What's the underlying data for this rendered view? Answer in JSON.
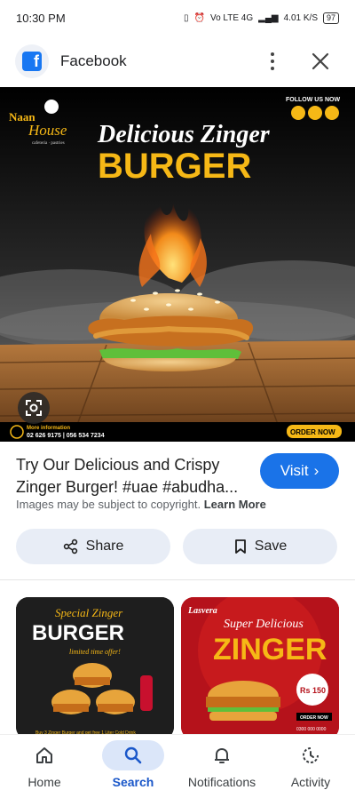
{
  "status_bar": {
    "time": "10:30 PM",
    "network": "Vo LTE 4G",
    "speed": "4.01 K/S",
    "battery": "97"
  },
  "header": {
    "app_title": "Facebook"
  },
  "hero": {
    "brand_top": "Naan",
    "brand_bottom": "House",
    "brand_sub": "cafeteria · pastries",
    "follow_text": "FOLLOW US NOW",
    "headline_1": "Delicious Zinger",
    "headline_2": "BURGER",
    "info_label": "More information",
    "phones": "02 626 9175 | 056 534 7234",
    "order_text": "ORDER NOW"
  },
  "result": {
    "title": "Try Our Delicious and Crispy Zinger Burger! #uae #abudha...",
    "visit_label": "Visit",
    "copyright_text": "Images may be subject to copyright.",
    "learn_more": "Learn More"
  },
  "actions": {
    "share_label": "Share",
    "save_label": "Save"
  },
  "related": [
    {
      "line1": "Special Zinger",
      "line2": "BURGER",
      "tag": "limited time offer!",
      "footer": "Buy 3 Zinger Burger and get free 1 Liter Cold Drink"
    },
    {
      "brand": "Lasvera",
      "line1": "Super Delicious",
      "line2": "ZINGER",
      "price": "Rs 150 Only",
      "order": "ORDER NOW",
      "footer": "0300 000 0000"
    }
  ],
  "nav": {
    "home": "Home",
    "search": "Search",
    "notifications": "Notifications",
    "activity": "Activity"
  },
  "colors": {
    "accent": "#1a73e8",
    "nav_active": "#1a57c9",
    "burger_yellow": "#f6b816"
  }
}
